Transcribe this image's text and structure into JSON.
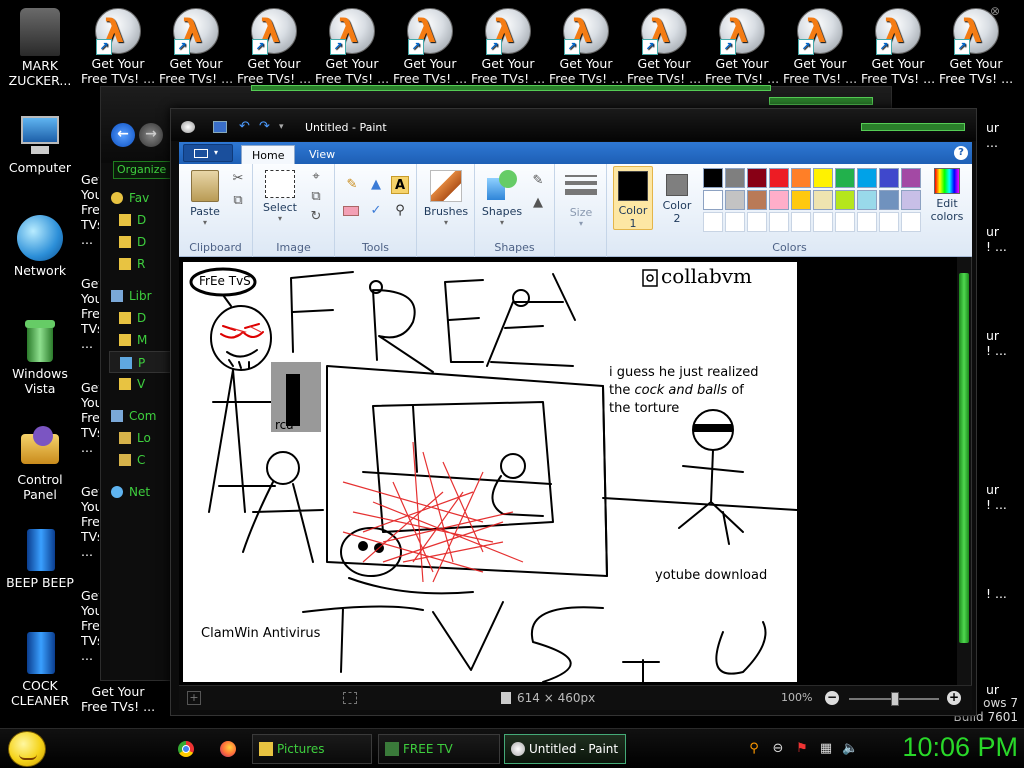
{
  "desktop": {
    "left_icons": [
      {
        "label": "MARK ZUCKER...",
        "icon": "zuckerberg-figure-icon"
      },
      {
        "label": "Computer",
        "icon": "computer-icon"
      },
      {
        "label": "Network",
        "icon": "network-globe-icon"
      },
      {
        "label": "Windows Vista",
        "icon": "recycle-bin-icon"
      },
      {
        "label": "Control Panel",
        "icon": "control-panel-icon"
      },
      {
        "label": "BEEP BEEP",
        "icon": "blue-file-icon"
      },
      {
        "label": "COCK CLEANER",
        "icon": "blue-file-icon"
      }
    ],
    "top_icons_label_1": "Get Your",
    "top_icons_label_2": "Free TVs! ...",
    "top_icons_label_2_short": "Free TVs!",
    "bottom_icon": {
      "label_1": "Get Your",
      "label_2": "Free TVs! ..."
    },
    "watermark": {
      "line1": "ows 7",
      "line2": "Build 7601"
    }
  },
  "explorer": {
    "organize": "Organize",
    "sidebar": [
      {
        "label": "Fav",
        "icon": "star-icon",
        "header": true
      },
      {
        "label": "D",
        "icon": "folder-icon"
      },
      {
        "label": "D",
        "icon": "folder-icon"
      },
      {
        "label": "R",
        "icon": "folder-icon"
      },
      {
        "label": "Libr",
        "icon": "library-icon",
        "header": true
      },
      {
        "label": "D",
        "icon": "document-icon"
      },
      {
        "label": "M",
        "icon": "music-icon"
      },
      {
        "label": "P",
        "icon": "pictures-icon",
        "selected": true
      },
      {
        "label": "V",
        "icon": "video-icon"
      },
      {
        "label": "Com",
        "icon": "computer-icon",
        "header": true
      },
      {
        "label": "Lo",
        "icon": "drive-icon"
      },
      {
        "label": "C",
        "icon": "drive-icon"
      },
      {
        "label": "Net",
        "icon": "network-icon",
        "header": true
      }
    ],
    "side_labels": [
      "Get Your",
      "Free TVs! ..."
    ]
  },
  "paint": {
    "title": "Untitled - Paint",
    "tabs": [
      {
        "label": "Home",
        "active": true
      },
      {
        "label": "View",
        "active": false
      }
    ],
    "groups": {
      "clipboard": "Clipboard",
      "image": "Image",
      "tools": "Tools",
      "shapes": "Shapes",
      "colors": "Colors"
    },
    "buttons": {
      "paste": "Paste",
      "select": "Select",
      "brushes": "Brushes",
      "shapes": "Shapes",
      "size": "Size",
      "color1": "Color",
      "color1_num": "1",
      "color2": "Color",
      "color2_num": "2",
      "edit_colors_1": "Edit",
      "edit_colors_2": "colors"
    },
    "palette_row1": [
      "#000000",
      "#7f7f7f",
      "#880015",
      "#ed1c24",
      "#ff7f27",
      "#fff200",
      "#22b14c",
      "#00a2e8",
      "#3f48cc",
      "#a349a4"
    ],
    "palette_row2": [
      "#ffffff",
      "#c3c3c3",
      "#b97a57",
      "#ffaec9",
      "#ffc90e",
      "#efe4b0",
      "#b5e61d",
      "#99d9ea",
      "#7092be",
      "#c8bfe7"
    ],
    "color1_value": "#000000",
    "color2_value": "#7f7f7f",
    "status": {
      "dimensions": "614 × 460px",
      "zoom": "100%"
    },
    "drawing": {
      "bubble": "FrEe TvS",
      "collabvm": "collabvm",
      "caption_line1": "i guess he just realized",
      "caption_line2_pre": "the ",
      "caption_line2_italic": "cock and balls",
      "caption_line2_post": " of",
      "caption_line3": "the torture",
      "rca": "rca",
      "ytdl": "yotube download",
      "clamwin": "ClamWin Antivirus",
      "free_text": "FREE",
      "tvs_text": "TVS"
    }
  },
  "taskbar": {
    "buttons": [
      {
        "label": "Pictures",
        "icon": "folder-icon"
      },
      {
        "label": "FREE TV",
        "icon": "explorer-icon"
      },
      {
        "label": "Untitled - Paint",
        "icon": "paint-icon",
        "active": true
      }
    ],
    "clock": "10:06 PM"
  }
}
